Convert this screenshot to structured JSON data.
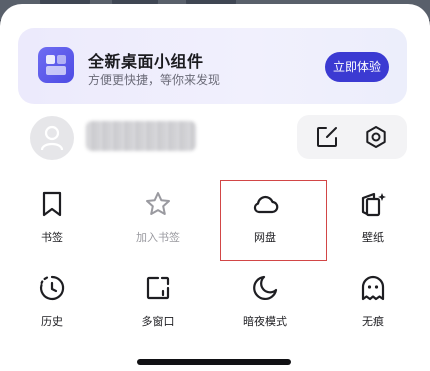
{
  "banner": {
    "title": "全新桌面小组件",
    "subtitle": "方便更快捷，等你来发现",
    "button_label": "立即体验",
    "accent": "#3b3ad2"
  },
  "account": {
    "avatar_icon": "user-icon",
    "tools": [
      {
        "name": "edit-icon"
      },
      {
        "name": "settings-icon"
      }
    ]
  },
  "menu": {
    "items": [
      {
        "label": "书签",
        "icon": "bookmark-icon",
        "enabled": true
      },
      {
        "label": "加入书签",
        "icon": "star-icon",
        "enabled": false
      },
      {
        "label": "网盘",
        "icon": "cloud-icon",
        "enabled": true,
        "highlighted": true
      },
      {
        "label": "壁纸",
        "icon": "wallpaper-icon",
        "enabled": true
      },
      {
        "label": "历史",
        "icon": "history-icon",
        "enabled": true
      },
      {
        "label": "多窗口",
        "icon": "multi-window-icon",
        "enabled": true
      },
      {
        "label": "暗夜模式",
        "icon": "moon-icon",
        "enabled": true
      },
      {
        "label": "无痕",
        "icon": "ghost-icon",
        "enabled": true
      }
    ]
  },
  "colors": {
    "highlight_border": "#d24646",
    "disabled_text": "#9a9aa0"
  }
}
